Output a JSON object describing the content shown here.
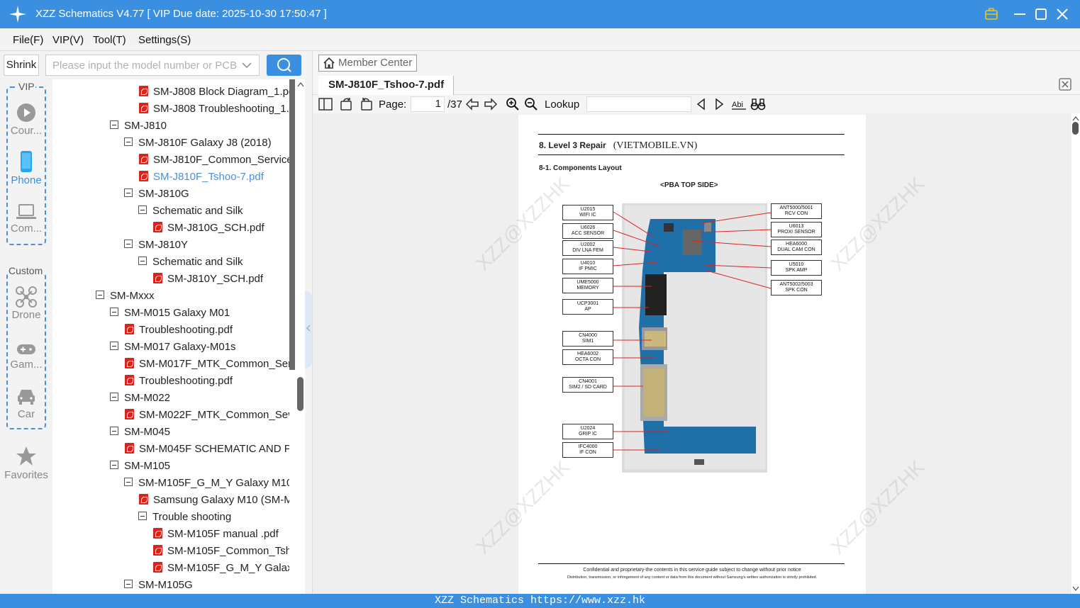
{
  "window": {
    "title": "XZZ Schematics V4.77 [ VIP Due date: 2025-10-30 17:50:47 ]"
  },
  "menu": [
    "File(F)",
    "VIP(V)",
    "Tool(T)",
    "Settings(S)"
  ],
  "toolbar": {
    "shrink": "Shrink",
    "search_placeholder": "Please input the model number or PCB"
  },
  "nav": {
    "vip_label": "VIP",
    "custom_label": "Custom",
    "items": [
      "Cour...",
      "Phone",
      "Com...",
      "Drone",
      "Gam...",
      "Car",
      "Favorites"
    ]
  },
  "tree": [
    "SM-J808 Block Diagram_1.pd",
    "SM-J808 Troubleshooting_1.",
    "SM-J810",
    "SM-J810F Galaxy J8 (2018)",
    "SM-J810F_Common_Service_",
    "SM-J810F_Tshoo-7.pdf",
    "SM-J810G",
    "Schematic and Silk",
    "SM-J810G_SCH.pdf",
    "SM-J810Y",
    "Schematic and Silk",
    "SM-J810Y_SCH.pdf",
    "SM-Mxxx",
    "SM-M015 Galaxy M01",
    "Troubleshooting.pdf",
    "SM-M017 Galaxy-M01s",
    "SM-M017F_MTK_Common_Serv",
    "Troubleshooting.pdf",
    "SM-M022",
    "SM-M022F_MTK_Common_Sevi",
    "SM-M045",
    "SM-M045F SCHEMATIC AND PC",
    "SM-M105",
    "SM-M105F_G_M_Y Galaxy M10",
    "Samsung Galaxy M10 (SM-M",
    "Trouble shooting",
    "SM-M105F manual .pdf",
    "SM-M105F_Common_Tsh",
    "SM-M105F_G_M_Y Galaxy",
    "SM-M105G"
  ],
  "viewer": {
    "member_center": "Member Center",
    "tab": "SM-J810F_Tshoo-7.pdf",
    "page_label": "Page:",
    "page_current": "1",
    "page_total": "/37",
    "lookup_label": "Lookup"
  },
  "pdf": {
    "heading": "8. Level 3 Repair",
    "heading_site": "(VIETMOBILE.VN)",
    "subheading": "8-1. Components Layout",
    "side": "<PBA TOP SIDE>",
    "labels_left": [
      [
        "U2015",
        "WIFI IC"
      ],
      [
        "U6026",
        "ACC SENSOR"
      ],
      [
        "U2002",
        "DIV LNA FEM"
      ],
      [
        "U4010",
        "IF PMIC"
      ],
      [
        "UME5000",
        "MEMORY"
      ],
      [
        "UCP3001",
        "AP"
      ],
      [
        "CN4000",
        "SIM1"
      ],
      [
        "HEA6002",
        "OCTA CON"
      ],
      [
        "CN4001",
        "SIM2 / SD CARD"
      ],
      [
        "U2024",
        "GRIP IC"
      ],
      [
        "IFC4000",
        "IF CON"
      ]
    ],
    "labels_right": [
      [
        "ANT5000/5001",
        "RCV CON"
      ],
      [
        "U6013",
        "PROXI SENSOR"
      ],
      [
        "HEA6000",
        "DUAL CAM CON"
      ],
      [
        "U5010",
        "SPK AMP"
      ],
      [
        "ANT5002/5003",
        "SPK CON"
      ]
    ],
    "footer1": "Confidential and proprietary-the contents in this service guide subject to change without prior notice",
    "footer2": "Distribution, transmission, or infringement of any content or data from this document without Samsung's written authorization is strictly prohibited.",
    "watermark": "XZZ@XZZHK"
  },
  "status": "XZZ Schematics https://www.xzz.hk"
}
